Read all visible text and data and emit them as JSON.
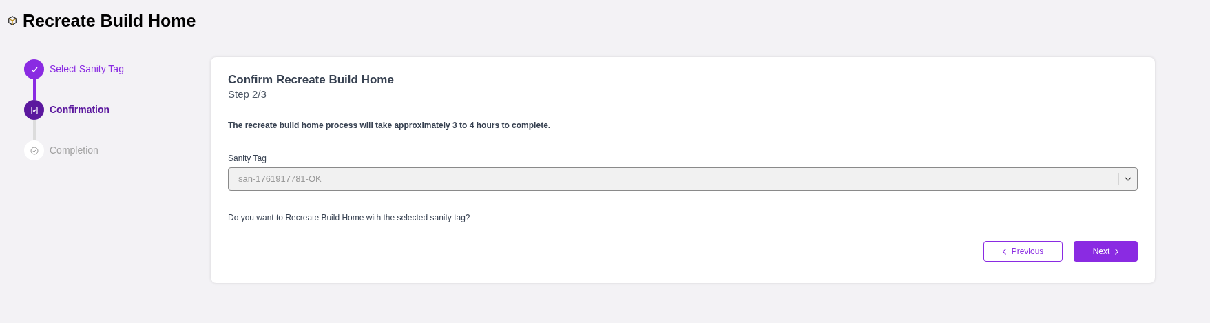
{
  "page": {
    "title": "Recreate Build Home"
  },
  "steps": [
    {
      "label": "Select Sanity Tag",
      "kind": "done"
    },
    {
      "label": "Confirmation",
      "kind": "current"
    },
    {
      "label": "Completion",
      "kind": "pending"
    }
  ],
  "card": {
    "title": "Confirm Recreate Build Home",
    "subtitle": "Step 2/3",
    "notice": "The recreate build home process will take approximately 3 to 4 hours to complete.",
    "field": {
      "label": "Sanity Tag",
      "value": "san-1761917781-OK",
      "disabled": true
    },
    "question": "Do you want to Recreate Build Home with the selected sanity tag?",
    "buttons": [
      {
        "label": "Previous",
        "kind": "secondary"
      },
      {
        "label": "Next",
        "kind": "primary"
      }
    ]
  }
}
